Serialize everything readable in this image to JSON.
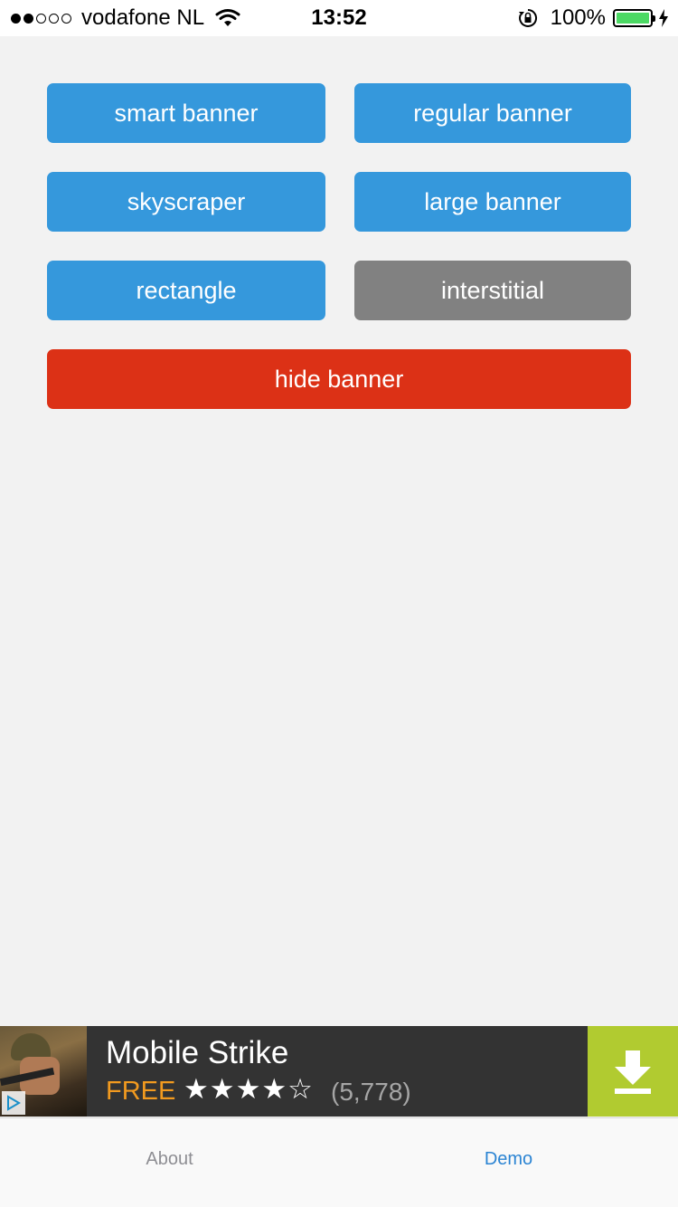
{
  "status_bar": {
    "signal": {
      "filled": 2,
      "total": 5
    },
    "carrier": "vodafone NL",
    "time": "13:52",
    "battery_percent": "100%",
    "battery_level": 1.0,
    "icons": [
      "wifi-icon",
      "rotation-lock-icon",
      "battery-icon",
      "charging-bolt-icon"
    ]
  },
  "buttons": {
    "smart_banner": "smart banner",
    "regular_banner": "regular banner",
    "skyscraper": "skyscraper",
    "large_banner": "large banner",
    "rectangle": "rectangle",
    "interstitial": "interstitial",
    "hide_banner": "hide banner"
  },
  "colors": {
    "blue": "#3598dc",
    "gray": "#818181",
    "red": "#dc3116",
    "ad_background": "#333333",
    "ad_download": "#b1cb30",
    "ad_free": "#f29a1f",
    "tab_active": "#2b84d3",
    "tab_inactive": "#8e8e93"
  },
  "ad": {
    "title": "Mobile Strike",
    "price": "FREE",
    "rating": 4,
    "rating_max": 5,
    "stars": "★★★★☆",
    "reviews": "(5,778)",
    "icons": [
      "adchoices-icon",
      "download-icon"
    ]
  },
  "tabs": {
    "about": "About",
    "demo": "Demo",
    "active": "Demo"
  }
}
